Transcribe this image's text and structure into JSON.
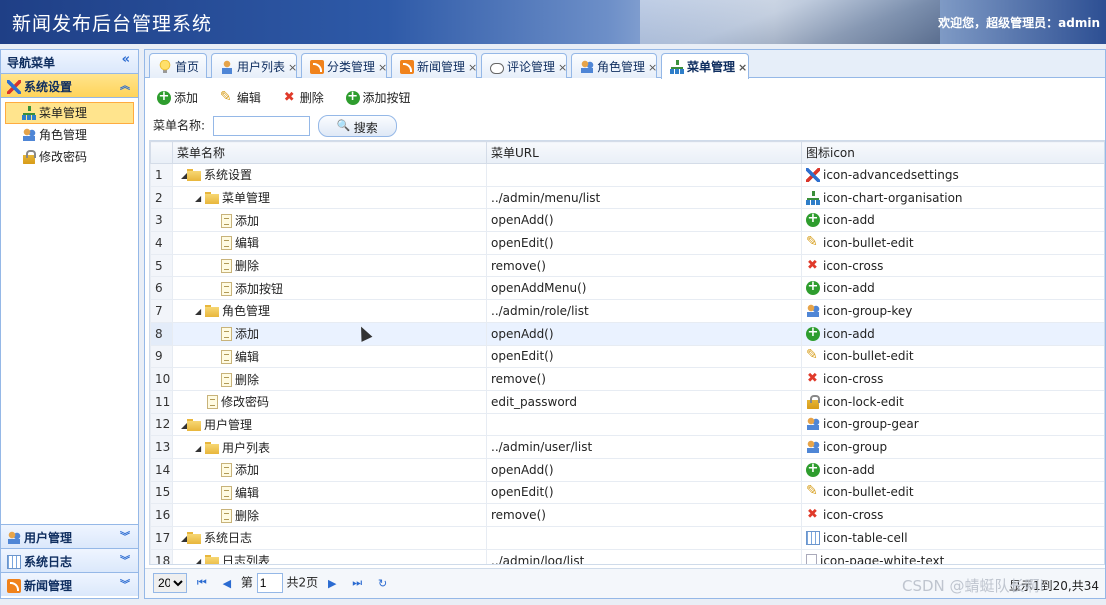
{
  "header": {
    "title": "新闻发布后台管理系统",
    "welcome": "欢迎您，超级管理员：admin"
  },
  "sidebar": {
    "title": "导航菜单",
    "collapse_icon": "«",
    "groups": [
      {
        "label": "系统设置",
        "icon": "settings-icon",
        "expanded": true,
        "items": [
          {
            "label": "菜单管理",
            "icon": "chart-organisation-icon",
            "active": true
          },
          {
            "label": "角色管理",
            "icon": "group-key-icon"
          },
          {
            "label": "修改密码",
            "icon": "lock-edit-icon"
          }
        ]
      },
      {
        "label": "用户管理",
        "icon": "group-icon"
      },
      {
        "label": "系统日志",
        "icon": "table-cell-icon"
      },
      {
        "label": "新闻管理",
        "icon": "rss-icon"
      }
    ]
  },
  "tabs": [
    {
      "label": "首页",
      "icon": "bulb-icon",
      "closable": false
    },
    {
      "label": "用户列表",
      "icon": "user-icon",
      "closable": true
    },
    {
      "label": "分类管理",
      "icon": "rss-icon",
      "closable": true
    },
    {
      "label": "新闻管理",
      "icon": "rss-icon",
      "closable": true
    },
    {
      "label": "评论管理",
      "icon": "comment-icon",
      "closable": true
    },
    {
      "label": "角色管理",
      "icon": "group-key-icon",
      "closable": true
    },
    {
      "label": "菜单管理",
      "icon": "chart-organisation-icon",
      "closable": true,
      "active": true
    }
  ],
  "toolbar": {
    "add": "添加",
    "edit": "编辑",
    "delete": "删除",
    "add_button": "添加按钮"
  },
  "search": {
    "label": "菜单名称:",
    "value": "",
    "button": "搜索"
  },
  "grid": {
    "columns": [
      "菜单名称",
      "菜单URL",
      "图标icon"
    ],
    "rows": [
      {
        "n": "1",
        "name": "系统设置",
        "url": "",
        "icon": "icon-advancedsettings"
      },
      {
        "n": "2",
        "name": "菜单管理",
        "url": "../admin/menu/list",
        "icon": "icon-chart-organisation"
      },
      {
        "n": "3",
        "name": "添加",
        "url": "openAdd()",
        "icon": "icon-add"
      },
      {
        "n": "4",
        "name": "编辑",
        "url": "openEdit()",
        "icon": "icon-bullet-edit"
      },
      {
        "n": "5",
        "name": "删除",
        "url": "remove()",
        "icon": "icon-cross"
      },
      {
        "n": "6",
        "name": "添加按钮",
        "url": "openAddMenu()",
        "icon": "icon-add"
      },
      {
        "n": "7",
        "name": "角色管理",
        "url": "../admin/role/list",
        "icon": "icon-group-key"
      },
      {
        "n": "8",
        "name": "添加",
        "url": "openAdd()",
        "icon": "icon-add"
      },
      {
        "n": "9",
        "name": "编辑",
        "url": "openEdit()",
        "icon": "icon-bullet-edit"
      },
      {
        "n": "10",
        "name": "删除",
        "url": "remove()",
        "icon": "icon-cross"
      },
      {
        "n": "11",
        "name": "修改密码",
        "url": "edit_password",
        "icon": "icon-lock-edit"
      },
      {
        "n": "12",
        "name": "用户管理",
        "url": "",
        "icon": "icon-group-gear"
      },
      {
        "n": "13",
        "name": "用户列表",
        "url": "../admin/user/list",
        "icon": "icon-group"
      },
      {
        "n": "14",
        "name": "添加",
        "url": "openAdd()",
        "icon": "icon-add"
      },
      {
        "n": "15",
        "name": "编辑",
        "url": "openEdit()",
        "icon": "icon-bullet-edit"
      },
      {
        "n": "16",
        "name": "删除",
        "url": "remove()",
        "icon": "icon-cross"
      },
      {
        "n": "17",
        "name": "系统日志",
        "url": "",
        "icon": "icon-table-cell"
      },
      {
        "n": "18",
        "name": "日志列表",
        "url": "../admin/log/list",
        "icon": "icon-page-white-text"
      }
    ]
  },
  "pager": {
    "page_size": "20",
    "page_prefix": "第",
    "page_value": "1",
    "page_total": "共2页",
    "info": "显示1到20,共34"
  },
  "watermark": "CSDN @蜻蜓队长啊i"
}
